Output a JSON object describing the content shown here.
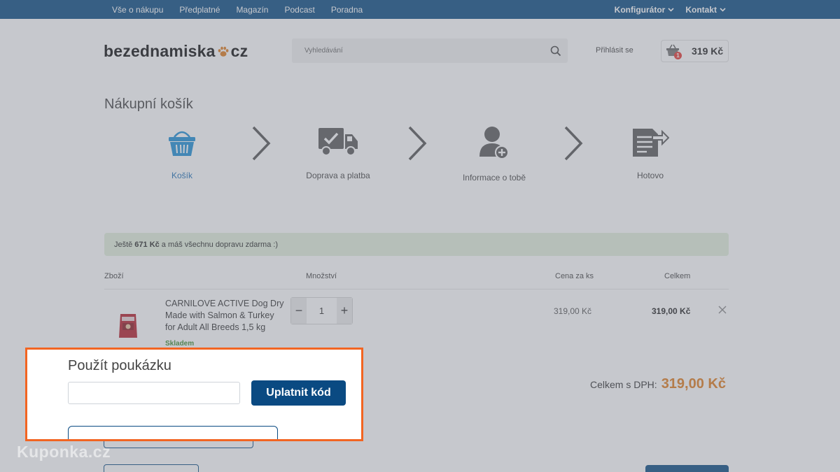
{
  "topnav": {
    "left": [
      "Vše o nákupu",
      "Předplatné",
      "Magazín",
      "Podcast",
      "Poradna"
    ],
    "right": [
      "Konfigurátor",
      "Kontakt"
    ]
  },
  "header": {
    "logo_text_1": "bezednamiska",
    "logo_text_2": "cz",
    "search_placeholder": "Vyhledávání",
    "login_label": "Přihlásit se",
    "cart_count": "1",
    "cart_total": "319 Kč"
  },
  "page_title": "Nákupní košík",
  "steps": [
    {
      "label": "Košík",
      "icon": "basket-icon"
    },
    {
      "label": "Doprava a platba",
      "icon": "truck-icon"
    },
    {
      "label": "Informace o tobě",
      "icon": "user-add-icon"
    },
    {
      "label": "Hotovo",
      "icon": "document-icon"
    }
  ],
  "shipping": {
    "prefix": "Ještě",
    "amount": "671 Kč",
    "suffix": "a máš všechnu dopravu zdarma :)"
  },
  "table": {
    "headers": {
      "product": "Zboží",
      "quantity": "Množství",
      "unit_price": "Cena za ks",
      "total": "Celkem"
    },
    "rows": [
      {
        "name": "CARNILOVE ACTIVE Dog Dry Made with Salmon & Turkey for Adult All Breeds 1,5 kg",
        "stock": "Skladem",
        "quantity": "1",
        "unit_price": "319,00 Kč",
        "total": "319,00 Kč"
      }
    ]
  },
  "summary": {
    "label": "Celkem s DPH:",
    "value": "319,00 Kč"
  },
  "voucher": {
    "title": "Použít poukázku",
    "input_value": "",
    "button_label": "Uplatnit kód"
  },
  "watermark": "Kuponka.cz",
  "colors": {
    "brand_blue": "#0a4a82",
    "accent_orange": "#e07c1e",
    "highlight_border": "#f26522",
    "stock_green": "#3c8a2e",
    "shipping_bg": "#e3f0dc"
  }
}
